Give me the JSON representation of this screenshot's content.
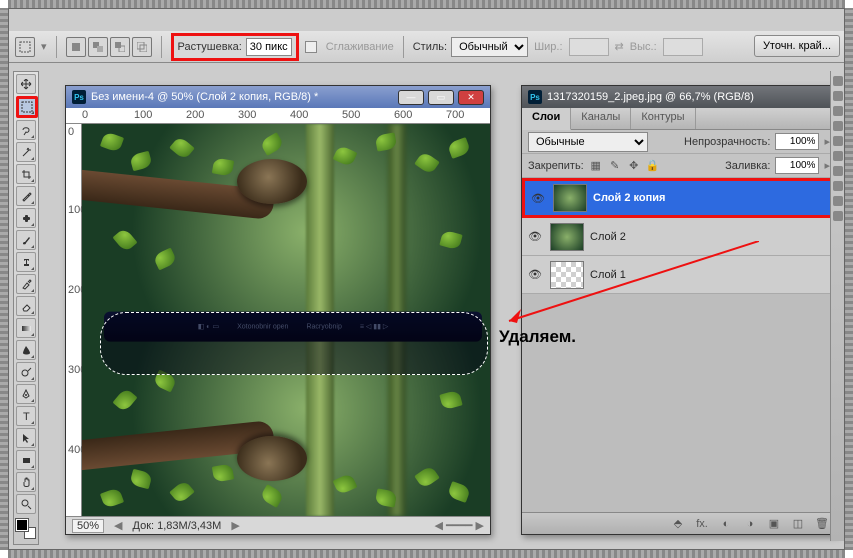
{
  "options": {
    "feather_label": "Растушевка:",
    "feather_value": "30 пикс",
    "antialias": "Сглаживание",
    "style_label": "Стиль:",
    "style_value": "Обычный",
    "width_label": "Шир.:",
    "height_label": "Выс.:",
    "refine": "Уточн. край..."
  },
  "doc1": {
    "title": "Без имени-4 @ 50% (Слой 2 копия, RGB/8) *",
    "ruler_h": [
      "0",
      "100",
      "200",
      "300",
      "400",
      "500",
      "600",
      "700"
    ],
    "ruler_v": [
      "0",
      "100",
      "200",
      "300",
      "400"
    ],
    "bar1": "Xotonobnir open",
    "bar2": "Racryobnip",
    "zoom": "50%",
    "docsize": "Док: 1,83M/3,43M"
  },
  "doc2": {
    "title": "1317320159_2.jpeg.jpg @ 66,7% (RGB/8)"
  },
  "panel": {
    "tabs": [
      "Слои",
      "Каналы",
      "Контуры"
    ],
    "blend": "Обычные",
    "opacity_label": "Непрозрачность:",
    "opacity": "100%",
    "lock_label": "Закрепить:",
    "fill_label": "Заливка:",
    "fill": "100%",
    "layers": [
      {
        "name": "Слой 2 копия",
        "sel": true,
        "img": true
      },
      {
        "name": "Слой 2",
        "sel": false,
        "img": true
      },
      {
        "name": "Слой 1",
        "sel": false,
        "img": false
      }
    ]
  },
  "annotation": "Удаляем."
}
